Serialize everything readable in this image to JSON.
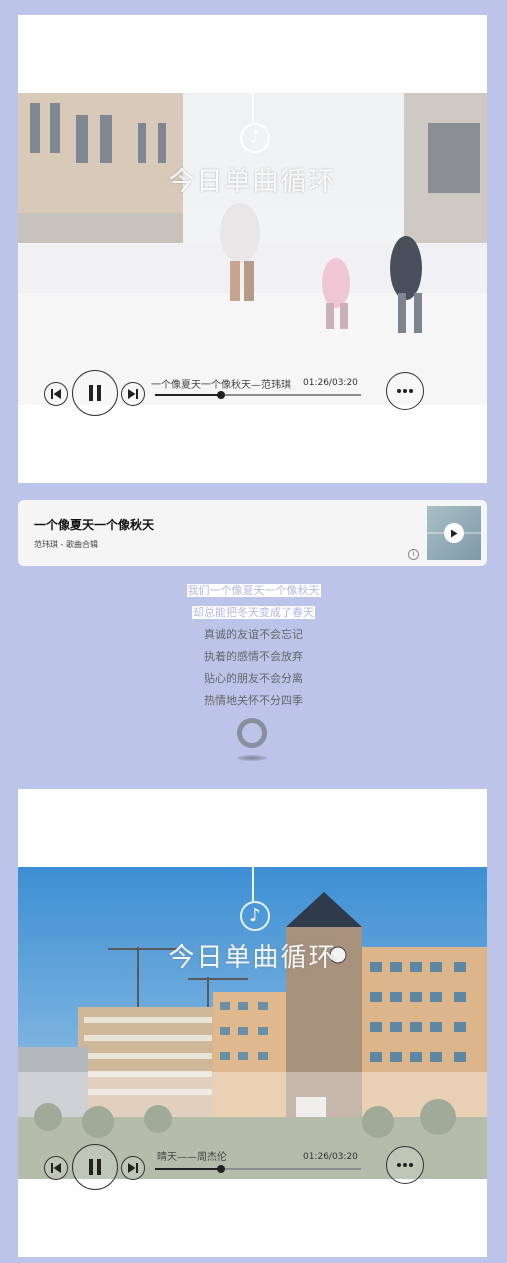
{
  "players": [
    {
      "headline": "今日单曲循环",
      "note_icon": "music-note-icon",
      "track_title": "一个像夏天一个像秋天—范玮琪",
      "time": "01:26/03:20",
      "progress": 0.32
    },
    {
      "headline": "今日单曲循环",
      "note_icon": "music-note-icon",
      "track_title": "晴天——周杰伦",
      "time": "01:26/03:20",
      "progress": 0.32
    }
  ],
  "song_card": {
    "title": "一个像夏天一个像秋天",
    "meta": "范玮琪 - 歌曲合辑",
    "info_icon": "info-icon"
  },
  "lyrics": [
    {
      "text": "我们一个像夏天一个像秋天",
      "highlight": true
    },
    {
      "text": "却总能把冬天变成了春天",
      "highlight": true
    },
    {
      "text": "真诚的友谊不会忘记",
      "highlight": false
    },
    {
      "text": "执着的感情不会放弃",
      "highlight": false
    },
    {
      "text": "贴心的朋友不会分离",
      "highlight": false
    },
    {
      "text": "热情地关怀不分四季",
      "highlight": false
    }
  ],
  "colors": {
    "background": "#bcc4ea",
    "card": "#ffffff",
    "lyric_highlight": "#b4b8e5",
    "lyric": "#666666"
  }
}
